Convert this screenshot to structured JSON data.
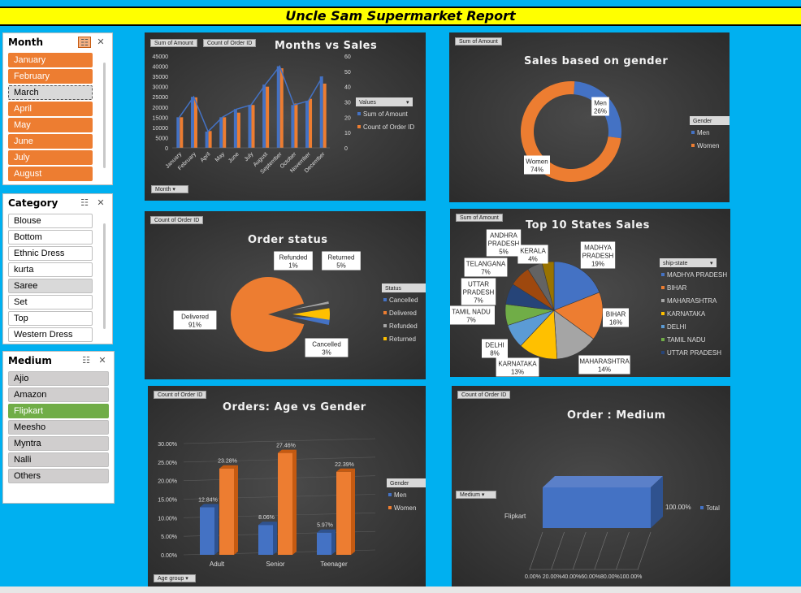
{
  "report_title": "Uncle Sam Supermarket Report",
  "colors": {
    "blue": "#4472c4",
    "orange": "#ed7d31",
    "grey": "#a5a5a5",
    "yellow": "#ffc000",
    "lightblue": "#5b9bd5",
    "green": "#70ad47",
    "navy": "#264478",
    "darkorange": "#9e480e",
    "darkgrey": "#636363",
    "gold": "#997300"
  },
  "slicers": {
    "month": {
      "title": "Month",
      "items": [
        "January",
        "February",
        "March",
        "April",
        "May",
        "June",
        "July",
        "August"
      ]
    },
    "category": {
      "title": "Category",
      "items": [
        "Blouse",
        "Bottom",
        "Ethnic Dress",
        "kurta",
        "Saree",
        "Set",
        "Top",
        "Western Dress"
      ]
    },
    "medium": {
      "title": "Medium",
      "items": [
        "Ajio",
        "Amazon",
        "Flipkart",
        "Meesho",
        "Myntra",
        "Nalli",
        "Others"
      ]
    }
  },
  "panels": {
    "months_sales": {
      "title": "Months vs Sales",
      "chips": [
        "Sum of Amount",
        "Count of Order ID"
      ],
      "filter_chip": "Month",
      "legend_title": "Values",
      "legend": [
        "Sum of Amount",
        "Count of Order ID"
      ],
      "y_left_ticks": [
        "45000",
        "40000",
        "35000",
        "30000",
        "25000",
        "20000",
        "15000",
        "10000",
        "5000",
        "0"
      ],
      "y_right_ticks": [
        "60",
        "50",
        "40",
        "30",
        "20",
        "10",
        "0"
      ]
    },
    "gender": {
      "title": "Sales based on gender",
      "chip": "Sum of Amount",
      "legend_title": "Gender",
      "legend": [
        "Men",
        "Women"
      ],
      "labels": [
        {
          "name": "Men",
          "pct": "26%"
        },
        {
          "name": "Women",
          "pct": "74%"
        }
      ]
    },
    "order_status": {
      "title": "Order status",
      "chip": "Count of Order ID",
      "legend_title": "Status",
      "legend": [
        "Cancelled",
        "Delivered",
        "Refunded",
        "Returned"
      ],
      "labels": [
        {
          "name": "Refunded",
          "pct": "1%"
        },
        {
          "name": "Returned",
          "pct": "5%"
        },
        {
          "name": "Delivered",
          "pct": "91%"
        },
        {
          "name": "Cancelled",
          "pct": "3%"
        }
      ]
    },
    "states": {
      "title": "Top 10 States Sales",
      "chip": "Sum of Amount",
      "legend_title": "ship-state",
      "legend": [
        "MADHYA PRADESH",
        "BIHAR",
        "MAHARASHTRA",
        "KARNATAKA",
        "DELHI",
        "TAMIL NADU",
        "UTTAR PRADESH"
      ],
      "labels": [
        {
          "name": "MADHYA PRADESH",
          "pct": "19%"
        },
        {
          "name": "BIHAR",
          "pct": "16%"
        },
        {
          "name": "MAHARASHTRA",
          "pct": "14%"
        },
        {
          "name": "KARNATAKA",
          "pct": "13%"
        },
        {
          "name": "DELHI",
          "pct": "8%"
        },
        {
          "name": "TAMIL NADU",
          "pct": "7%"
        },
        {
          "name": "UTTAR PRADESH",
          "pct": "7%"
        },
        {
          "name": "TELANGANA",
          "pct": "7%"
        },
        {
          "name": "ANDHRA PRADESH",
          "pct": "5%"
        },
        {
          "name": "KERALA",
          "pct": "4%"
        }
      ]
    },
    "age_gender": {
      "title": "Orders: Age vs Gender",
      "chip": "Count of Order ID",
      "filter_chip": "Age group",
      "legend_title": "Gender",
      "legend": [
        "Men",
        "Women"
      ],
      "y_ticks": [
        "30.00%",
        "25.00%",
        "20.00%",
        "15.00%",
        "10.00%",
        "5.00%",
        "0.00%"
      ]
    },
    "medium": {
      "title": "Order : Medium",
      "chip": "Count of Order ID",
      "filter_chip": "Medium",
      "legend": [
        "Total"
      ],
      "x_ticks_text": "0.00% 20.00%40.00%60.00%80.00%100.00%"
    }
  },
  "chart_data": [
    {
      "type": "bar",
      "title": "Months vs Sales",
      "categories": [
        "January",
        "February",
        "April",
        "May",
        "June",
        "July",
        "August",
        "September",
        "October",
        "November",
        "December"
      ],
      "series": [
        {
          "name": "Sum of Amount",
          "values": [
            15000,
            25000,
            8000,
            15000,
            19000,
            21000,
            31000,
            40000,
            21000,
            23000,
            35000
          ]
        },
        {
          "name": "Count of Order ID",
          "values": [
            20,
            33,
            11,
            20,
            23,
            28,
            40,
            52,
            29,
            32,
            42
          ]
        }
      ],
      "ylim": [
        0,
        45000
      ],
      "y2lim": [
        0,
        60
      ]
    },
    {
      "type": "pie",
      "title": "Sales based on gender",
      "categories": [
        "Men",
        "Women"
      ],
      "values": [
        26,
        74
      ]
    },
    {
      "type": "pie",
      "title": "Order status",
      "categories": [
        "Cancelled",
        "Delivered",
        "Refunded",
        "Returned"
      ],
      "values": [
        3,
        91,
        1,
        5
      ]
    },
    {
      "type": "pie",
      "title": "Top 10 States Sales",
      "categories": [
        "MADHYA PRADESH",
        "BIHAR",
        "MAHARASHTRA",
        "KARNATAKA",
        "DELHI",
        "TAMIL NADU",
        "UTTAR PRADESH",
        "TELANGANA",
        "ANDHRA PRADESH",
        "KERALA"
      ],
      "values": [
        19,
        16,
        14,
        13,
        8,
        7,
        7,
        7,
        5,
        4
      ]
    },
    {
      "type": "bar",
      "title": "Orders: Age vs Gender",
      "categories": [
        "Adult",
        "Senior",
        "Teenager"
      ],
      "series": [
        {
          "name": "Men",
          "values": [
            12.84,
            8.06,
            5.97
          ],
          "labels": [
            "12.84%",
            "8.06%",
            "5.97%"
          ]
        },
        {
          "name": "Women",
          "values": [
            23.28,
            27.46,
            22.39
          ],
          "labels": [
            "23.28%",
            "27.46%",
            "22.39%"
          ]
        }
      ],
      "ylim": [
        0,
        30
      ]
    },
    {
      "type": "bar",
      "title": "Order : Medium",
      "categories": [
        "Flipkart"
      ],
      "series": [
        {
          "name": "Total",
          "values": [
            100
          ],
          "labels": [
            "100.00%"
          ]
        }
      ],
      "xlim": [
        0,
        100
      ]
    }
  ]
}
